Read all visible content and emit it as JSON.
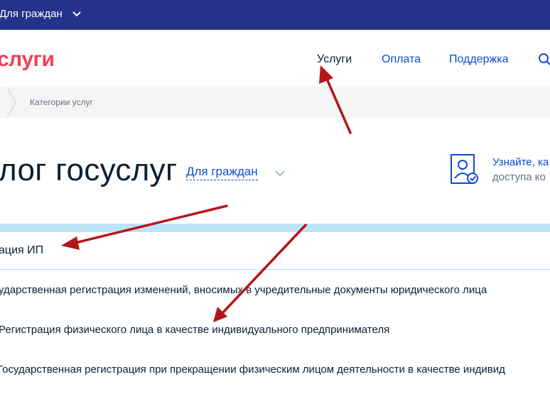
{
  "topbar": {
    "audience_label": "Для граждан",
    "chevron_icon": "chevron-down-icon"
  },
  "header": {
    "logo_text": "слуги",
    "nav": {
      "services": "Услуги",
      "payment": "Оплата",
      "support": "Поддержка"
    },
    "search_icon": "search-icon"
  },
  "breadcrumb": {
    "current": "Категории услуг"
  },
  "catalog": {
    "title": "лог госуслуг",
    "audience_selector": "Для граждан",
    "info": {
      "link_text": "Узнайте, ка",
      "sub_text": "доступа ко"
    }
  },
  "category": {
    "title": "ация ИП",
    "services": [
      "ударственная регистрация изменений, вносимых в учредительные документы юридического лица",
      "Регистрация физического лица в качестве индивидуального предпринимателя",
      "Государственная регистрация при прекращении физическим лицом деятельности в качестве индивид"
    ]
  },
  "colors": {
    "topbar": "#25328a",
    "logo": "#ee3f58",
    "link": "#0d4cd3",
    "band": "#bde3f7",
    "annotation_arrow": "#b5141c"
  }
}
